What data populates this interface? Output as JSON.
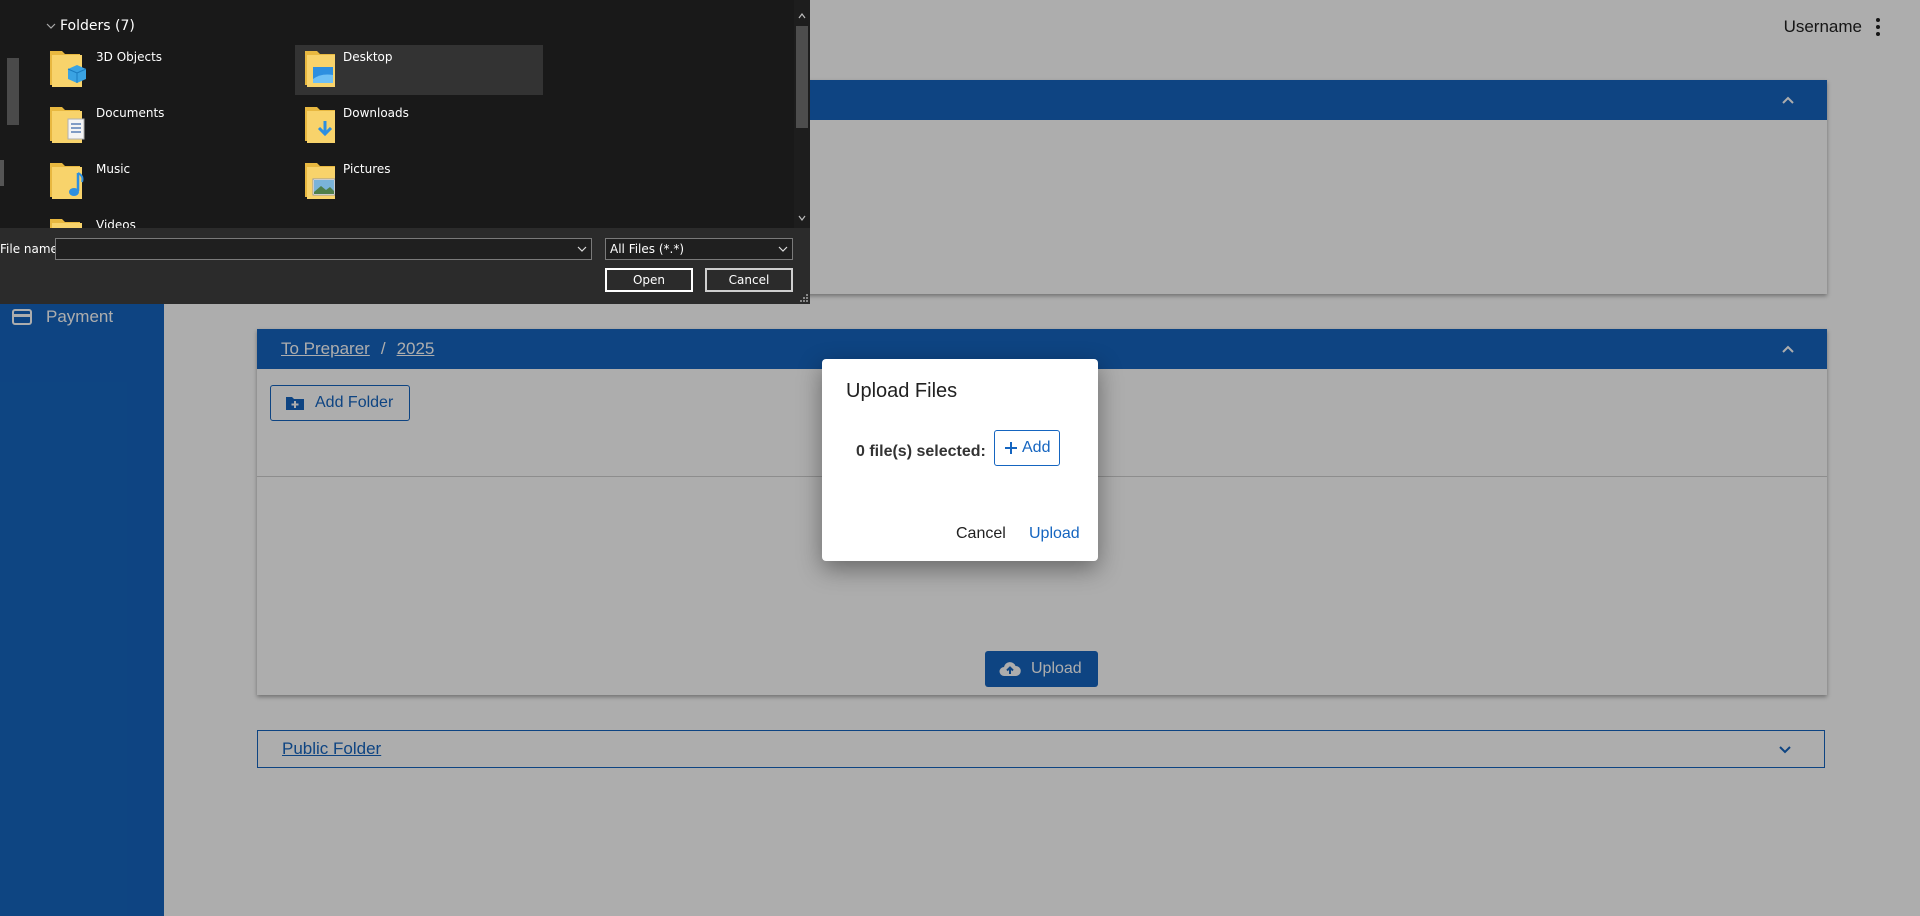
{
  "topbar": {
    "username": "Username"
  },
  "sidebar": {
    "items": [
      {
        "label": "Payment",
        "icon": "credit-card-icon"
      }
    ]
  },
  "panels": {
    "to_preparer": {
      "breadcrumb": [
        "To Preparer",
        "2025"
      ],
      "separator": "/",
      "add_folder_label": "Add Folder",
      "upload_label": "Upload"
    },
    "public_folder": {
      "label": "Public Folder"
    }
  },
  "upload_dialog": {
    "title": "Upload Files",
    "count_text": "0 file(s) selected:",
    "add_label": "Add",
    "cancel_label": "Cancel",
    "upload_label": "Upload"
  },
  "file_picker": {
    "group_label": "Folders (7)",
    "folders": [
      {
        "name": "3D Objects",
        "icon": "3d-objects-folder-icon"
      },
      {
        "name": "Desktop",
        "icon": "desktop-folder-icon",
        "selected": true
      },
      {
        "name": "Documents",
        "icon": "documents-folder-icon"
      },
      {
        "name": "Downloads",
        "icon": "downloads-folder-icon"
      },
      {
        "name": "Music",
        "icon": "music-folder-icon"
      },
      {
        "name": "Pictures",
        "icon": "pictures-folder-icon"
      },
      {
        "name": "Videos",
        "icon": "videos-folder-icon"
      }
    ],
    "filename_label": "File name:",
    "filename_value": "",
    "filter_value": "All Files (*.*)",
    "open_label": "Open",
    "cancel_label": "Cancel"
  },
  "colors": {
    "primary": "#1565c0",
    "picker_bg": "#191919"
  }
}
